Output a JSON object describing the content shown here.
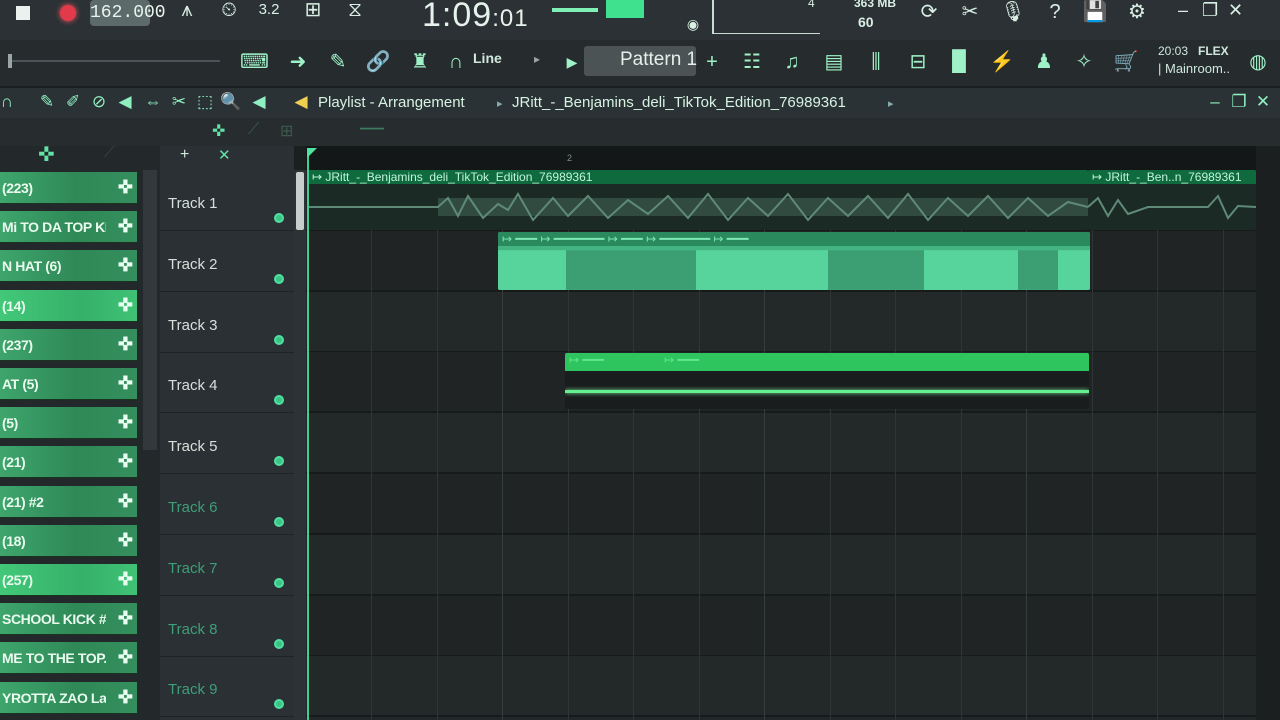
{
  "transport": {
    "tempo": "162.000",
    "time_main": "1:09",
    "time_sub": ":01",
    "time_sig": "3.2",
    "cpu_value": "4",
    "memory": "363 MB",
    "polyphony": "60"
  },
  "toolbar": {
    "snap_mode": "Line",
    "pattern_name": "Pattern 1",
    "hint_time": "20:03",
    "hint_flex": "FLEX",
    "hint_room": "| Mainroom.."
  },
  "playlist": {
    "title": "Playlist - Arrangement",
    "file": "JRitt_-_Benjamins_deli_TikTok_Edition_76989361",
    "ruler_bar": "2"
  },
  "channels": [
    {
      "label": "(223)",
      "bright": false
    },
    {
      "label": "Mi TO DA TOP KI..",
      "bright": false
    },
    {
      "label": "N HAT (6)",
      "bright": false
    },
    {
      "label": "(14)",
      "bright": true
    },
    {
      "label": "(237)",
      "bright": false
    },
    {
      "label": "AT (5)",
      "bright": false
    },
    {
      "label": "(5)",
      "bright": false
    },
    {
      "label": "(21)",
      "bright": false
    },
    {
      "label": "(21) #2",
      "bright": false
    },
    {
      "label": "(18)",
      "bright": false
    },
    {
      "label": "(257)",
      "bright": true
    },
    {
      "label": "SCHOOL KICK #2",
      "bright": false
    },
    {
      "label": "ME TO THE TOP..",
      "bright": false
    },
    {
      "label": "YROTTA ZAO Laug..",
      "bright": false
    }
  ],
  "tracks": [
    {
      "name": "Track 1",
      "dim": false
    },
    {
      "name": "Track 2",
      "dim": false
    },
    {
      "name": "Track 3",
      "dim": false
    },
    {
      "name": "Track 4",
      "dim": false
    },
    {
      "name": "Track 5",
      "dim": false
    },
    {
      "name": "Track 6",
      "dim": true
    },
    {
      "name": "Track 7",
      "dim": true
    },
    {
      "name": "Track 8",
      "dim": true
    },
    {
      "name": "Track 9",
      "dim": true
    }
  ],
  "clips": {
    "track1_name": "JRitt_-_Benjamins_deli_TikTok_Edition_76989361",
    "track1_tail_name": "JRitt_-_Ben..n_76989361"
  },
  "colors": {
    "accent": "#3fcf92",
    "channel_green": "#2f8957",
    "record_red": "#e23a4a"
  }
}
